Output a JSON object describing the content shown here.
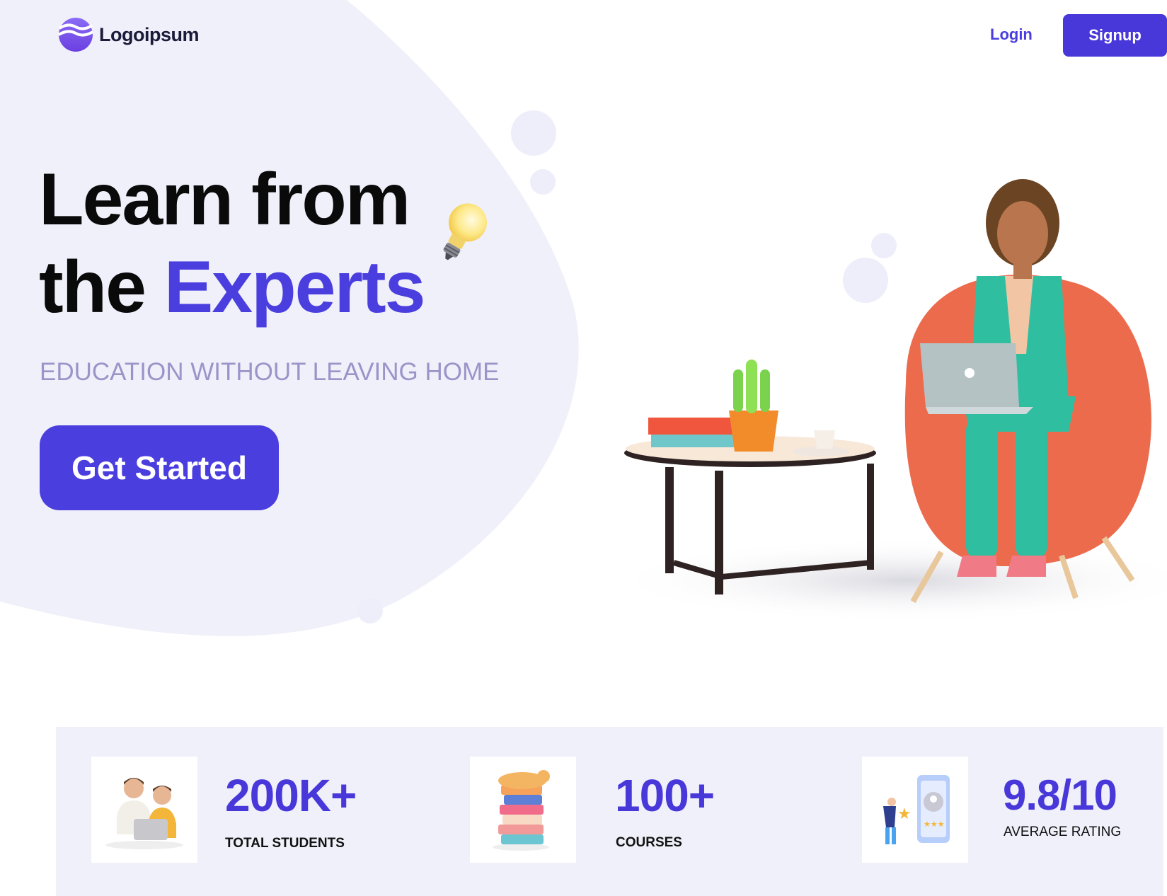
{
  "header": {
    "logo_text": "Logoipsum",
    "login_label": "Login",
    "signup_label": "Signup"
  },
  "hero": {
    "headline_line1": "Learn from",
    "headline_line2_plain": "the ",
    "headline_line2_accent": "Experts",
    "subtitle": "EDUCATION WITHOUT LEAVING HOME",
    "cta_label": "Get Started"
  },
  "stats": [
    {
      "value": "200K+",
      "label": "TOTAL STUDENTS",
      "icon": "students-icon"
    },
    {
      "value": "100+",
      "label": "COURSES",
      "icon": "books-icon"
    },
    {
      "value": "9.8/10",
      "label": "AVERAGE RATING",
      "icon": "rating-icon"
    }
  ],
  "colors": {
    "accent": "#4a3fde",
    "button": "#4838d9",
    "blob": "#f0f0fa",
    "subtitle": "#9a95c9"
  }
}
